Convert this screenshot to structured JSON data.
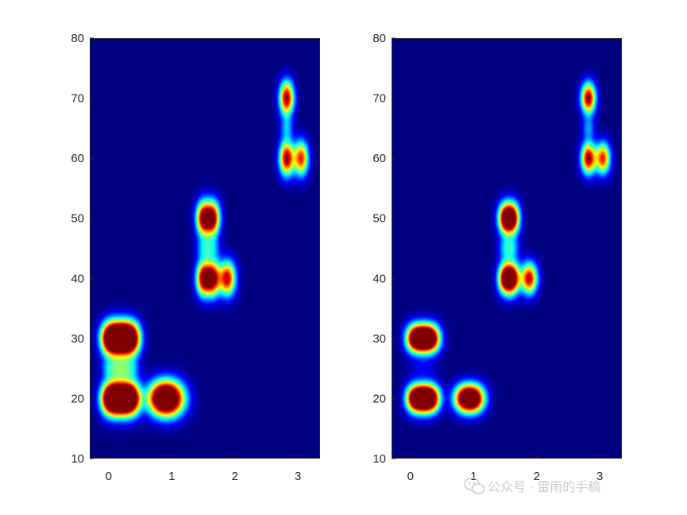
{
  "chart_data": [
    {
      "type": "heatmap",
      "title": "",
      "xlabel": "",
      "ylabel": "",
      "xlim": [
        -0.3,
        3.35
      ],
      "ylim": [
        10,
        80
      ],
      "x_ticks": [
        "0",
        "1",
        "2",
        "3"
      ],
      "y_ticks": [
        "10",
        "20",
        "30",
        "40",
        "50",
        "60",
        "70",
        "80"
      ],
      "colormap": "jet",
      "colorscale_min": 0,
      "colorscale_max": 1,
      "grid": false,
      "spots": [
        {
          "x": 0.0,
          "y": 20,
          "w": 0.1,
          "h": 1.9,
          "amp": 1.0
        },
        {
          "x": 0.125,
          "y": 20,
          "w": 0.1,
          "h": 1.9,
          "amp": 1.0
        },
        {
          "x": 0.25,
          "y": 20,
          "w": 0.1,
          "h": 1.9,
          "amp": 1.0
        },
        {
          "x": 0.375,
          "y": 20,
          "w": 0.1,
          "h": 1.9,
          "amp": 1.0
        },
        {
          "x": 0.0,
          "y": 30,
          "w": 0.1,
          "h": 1.9,
          "amp": 1.0
        },
        {
          "x": 0.125,
          "y": 30,
          "w": 0.1,
          "h": 1.9,
          "amp": 1.0
        },
        {
          "x": 0.25,
          "y": 30,
          "w": 0.1,
          "h": 1.9,
          "amp": 1.0
        },
        {
          "x": 0.375,
          "y": 30,
          "w": 0.1,
          "h": 1.9,
          "amp": 1.0
        },
        {
          "x": 0.0,
          "y": 25,
          "w": 0.09,
          "h": 1.2,
          "amp": 0.22
        },
        {
          "x": 0.125,
          "y": 25,
          "w": 0.09,
          "h": 1.2,
          "amp": 0.22
        },
        {
          "x": 0.25,
          "y": 25,
          "w": 0.09,
          "h": 1.2,
          "amp": 0.22
        },
        {
          "x": 0.375,
          "y": 25,
          "w": 0.09,
          "h": 1.2,
          "amp": 0.22
        },
        {
          "x": 0.82,
          "y": 20,
          "w": 0.16,
          "h": 2.0,
          "amp": 0.95
        },
        {
          "x": 1.0,
          "y": 20,
          "w": 0.16,
          "h": 2.0,
          "amp": 0.95
        },
        {
          "x": 1.5,
          "y": 40,
          "w": 0.08,
          "h": 2.0,
          "amp": 1.0
        },
        {
          "x": 1.65,
          "y": 40,
          "w": 0.08,
          "h": 2.0,
          "amp": 1.0
        },
        {
          "x": 1.5,
          "y": 50,
          "w": 0.08,
          "h": 2.0,
          "amp": 1.0
        },
        {
          "x": 1.65,
          "y": 50,
          "w": 0.08,
          "h": 2.0,
          "amp": 1.0
        },
        {
          "x": 1.5,
          "y": 45,
          "w": 0.08,
          "h": 1.3,
          "amp": 0.25
        },
        {
          "x": 1.65,
          "y": 45,
          "w": 0.08,
          "h": 1.3,
          "amp": 0.25
        },
        {
          "x": 1.88,
          "y": 40,
          "w": 0.09,
          "h": 2.0,
          "amp": 0.95
        },
        {
          "x": 2.82,
          "y": 60,
          "w": 0.08,
          "h": 2.0,
          "amp": 1.0
        },
        {
          "x": 2.82,
          "y": 70,
          "w": 0.08,
          "h": 2.0,
          "amp": 1.0
        },
        {
          "x": 2.82,
          "y": 65,
          "w": 0.07,
          "h": 1.3,
          "amp": 0.25
        },
        {
          "x": 3.05,
          "y": 60,
          "w": 0.08,
          "h": 2.0,
          "amp": 0.85
        }
      ]
    },
    {
      "type": "heatmap",
      "title": "",
      "xlabel": "",
      "ylabel": "",
      "xlim": [
        -0.3,
        3.35
      ],
      "ylim": [
        10,
        80
      ],
      "x_ticks": [
        "0",
        "1",
        "2",
        "3"
      ],
      "y_ticks": [
        "10",
        "20",
        "30",
        "40",
        "50",
        "60",
        "70",
        "80"
      ],
      "colormap": "jet",
      "colorscale_min": 0,
      "colorscale_max": 1,
      "grid": false,
      "spots": [
        {
          "x": 0.06,
          "y": 20,
          "w": 0.1,
          "h": 1.6,
          "amp": 1.0
        },
        {
          "x": 0.2,
          "y": 20,
          "w": 0.1,
          "h": 1.6,
          "amp": 1.0
        },
        {
          "x": 0.34,
          "y": 20,
          "w": 0.1,
          "h": 1.6,
          "amp": 1.0
        },
        {
          "x": 0.06,
          "y": 30,
          "w": 0.1,
          "h": 1.6,
          "amp": 1.0
        },
        {
          "x": 0.2,
          "y": 30,
          "w": 0.1,
          "h": 1.6,
          "amp": 1.0
        },
        {
          "x": 0.34,
          "y": 30,
          "w": 0.1,
          "h": 1.6,
          "amp": 1.0
        },
        {
          "x": 0.2,
          "y": 25,
          "w": 0.14,
          "h": 1.0,
          "amp": 0.1
        },
        {
          "x": 0.85,
          "y": 20,
          "w": 0.12,
          "h": 1.6,
          "amp": 1.0
        },
        {
          "x": 1.02,
          "y": 20,
          "w": 0.12,
          "h": 1.6,
          "amp": 1.0
        },
        {
          "x": 1.5,
          "y": 40,
          "w": 0.08,
          "h": 1.8,
          "amp": 1.0
        },
        {
          "x": 1.62,
          "y": 40,
          "w": 0.08,
          "h": 1.8,
          "amp": 1.0
        },
        {
          "x": 1.5,
          "y": 50,
          "w": 0.08,
          "h": 1.8,
          "amp": 1.0
        },
        {
          "x": 1.62,
          "y": 50,
          "w": 0.08,
          "h": 1.8,
          "amp": 1.0
        },
        {
          "x": 1.5,
          "y": 45,
          "w": 0.08,
          "h": 1.3,
          "amp": 0.25
        },
        {
          "x": 1.62,
          "y": 45,
          "w": 0.08,
          "h": 1.3,
          "amp": 0.25
        },
        {
          "x": 1.88,
          "y": 40,
          "w": 0.09,
          "h": 1.8,
          "amp": 0.95
        },
        {
          "x": 2.82,
          "y": 60,
          "w": 0.08,
          "h": 1.8,
          "amp": 1.0
        },
        {
          "x": 2.82,
          "y": 70,
          "w": 0.08,
          "h": 1.8,
          "amp": 1.0
        },
        {
          "x": 2.82,
          "y": 65,
          "w": 0.07,
          "h": 1.3,
          "amp": 0.25
        },
        {
          "x": 3.05,
          "y": 60,
          "w": 0.08,
          "h": 1.8,
          "amp": 0.85
        }
      ]
    }
  ],
  "watermark": {
    "text": "公众号 · 雷雨的手稿",
    "icon": "wechat-icon"
  }
}
